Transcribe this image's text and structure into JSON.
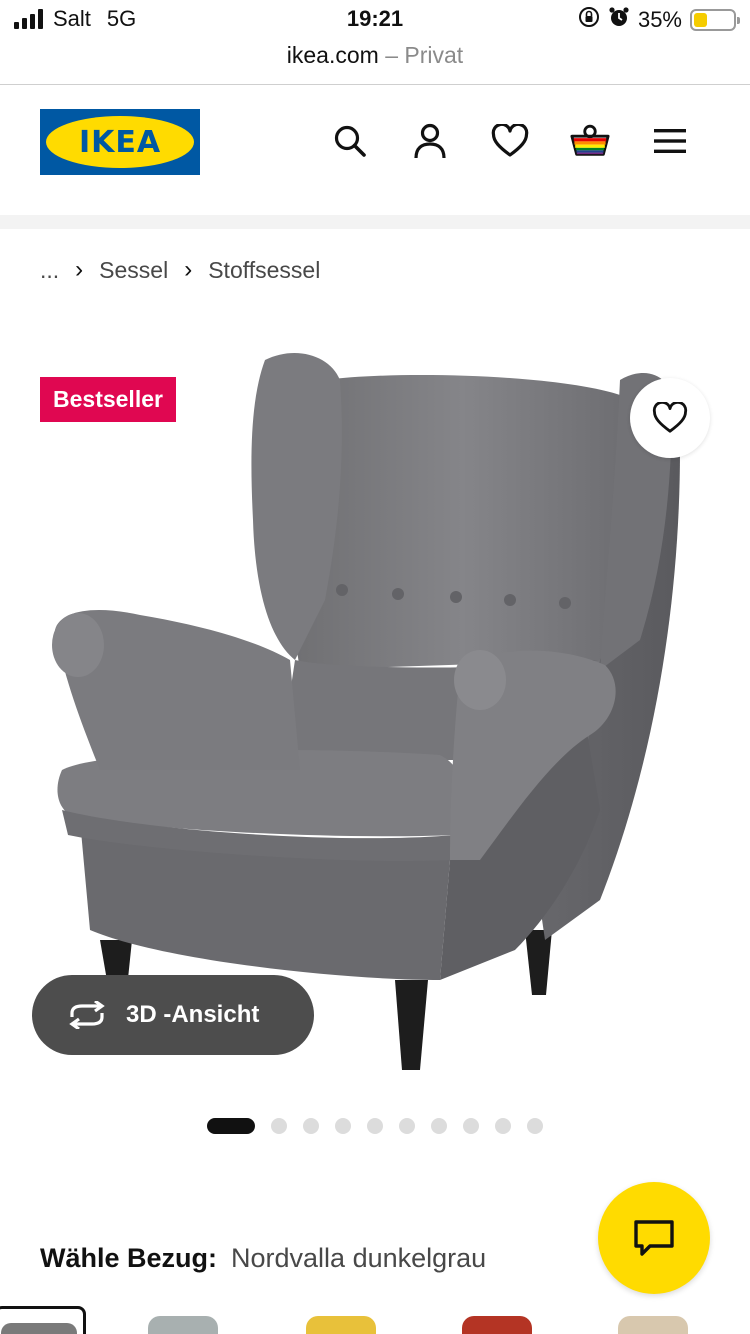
{
  "status_bar": {
    "carrier": "Salt",
    "network": "5G",
    "time": "19:21",
    "battery": "35%",
    "battery_level": 0.35,
    "battery_color": "#f5cc00"
  },
  "url_bar": {
    "domain": "ikea.com",
    "mode": "– Privat"
  },
  "header": {
    "logo_text": "IKEA",
    "brand_blue": "#0058a3",
    "brand_yellow": "#ffdb00",
    "icons": [
      "search-icon",
      "account-icon",
      "favourites-icon",
      "cart-icon",
      "menu-icon"
    ]
  },
  "breadcrumb": {
    "ellipsis": "...",
    "separator": "›",
    "items": [
      "Sessel",
      "Stoffsessel"
    ]
  },
  "product": {
    "badge": "Bestseller",
    "badge_color": "#e00751",
    "view_3d_label": "3D -Ansicht",
    "image_count": 10,
    "active_image": 1
  },
  "cover": {
    "label": "Wähle Bezug:",
    "value": "Nordvalla dunkelgrau"
  },
  "swatches": [
    {
      "name": "Nordvalla dunkelgrau",
      "color": "#7a7a7a",
      "selected": true
    },
    {
      "name": "check",
      "color": "#a8b0b0",
      "selected": false
    },
    {
      "name": "yellow",
      "color": "#e8c13a",
      "selected": false
    },
    {
      "name": "red",
      "color": "#b43424",
      "selected": false
    },
    {
      "name": "beige",
      "color": "#d8c8ae",
      "selected": false
    }
  ]
}
